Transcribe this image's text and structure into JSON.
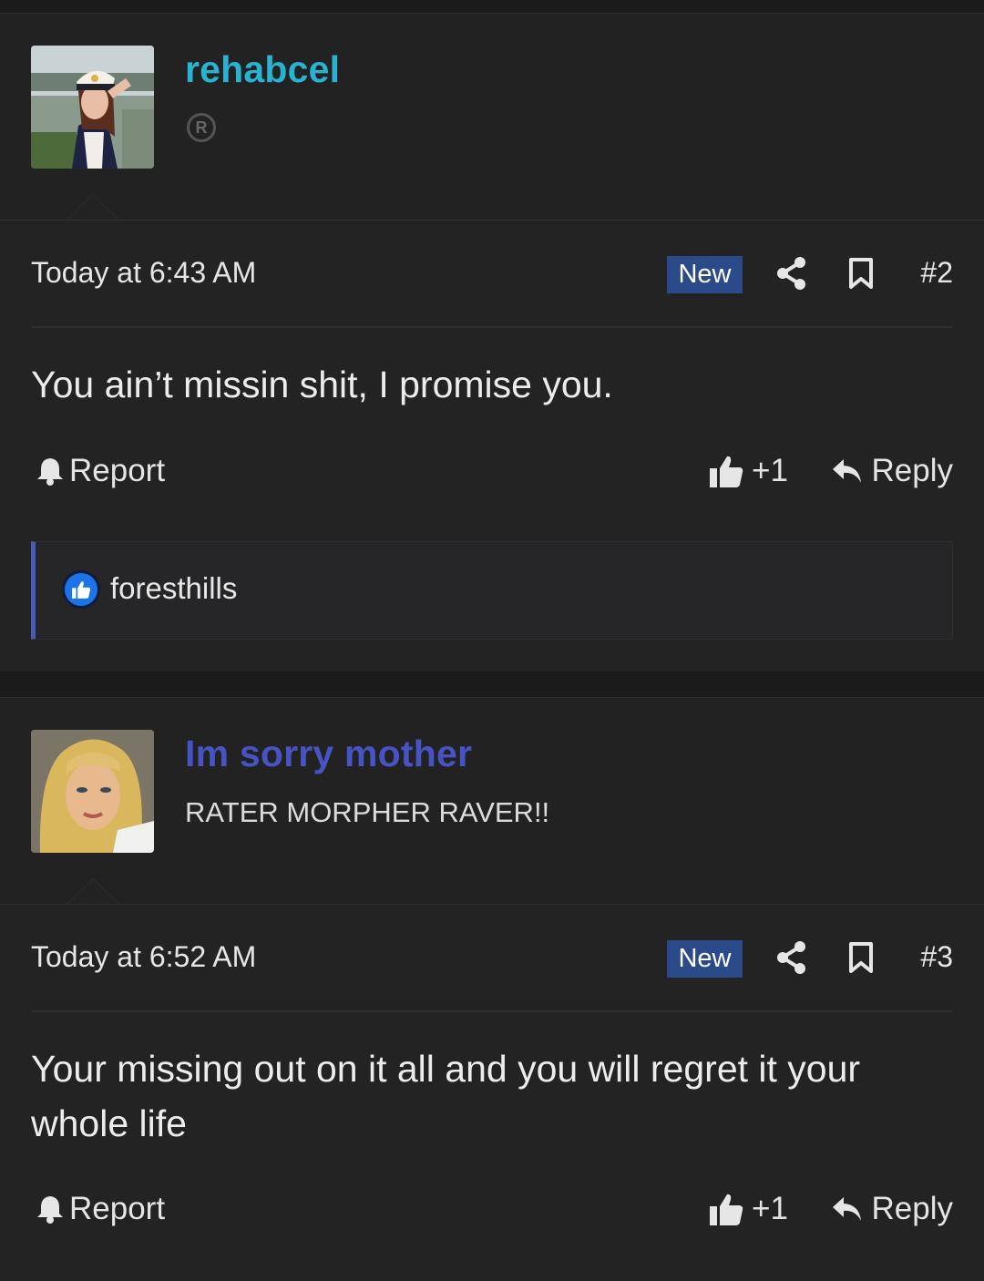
{
  "posts": [
    {
      "username": "rehabcel",
      "user_badge": "R",
      "avatar": "avatar-woman-captain-hat",
      "timestamp": "Today at 6:43 AM",
      "new_label": "New",
      "post_number": "#2",
      "body": "You ain’t missin shit, I promise you.",
      "report_label": "Report",
      "like_count": "+1",
      "reply_label": "Reply",
      "reactions": {
        "icon": "like-reaction-icon",
        "users": "foresthills"
      }
    },
    {
      "username": "Im sorry mother",
      "user_title": "RATER MORPHER RAVER!!",
      "avatar": "avatar-blonde-woman",
      "timestamp": "Today at 6:52 AM",
      "new_label": "New",
      "post_number": "#3",
      "body": "Your missing out on it all and you will regret it your whole life",
      "report_label": "Report",
      "like_count": "+1",
      "reply_label": "Reply"
    }
  ],
  "colors": {
    "username_1": "#29b3d0",
    "username_2": "#4753c3",
    "new_badge": "#2b4a8a",
    "reaction_accent": "#4a5bb8"
  }
}
